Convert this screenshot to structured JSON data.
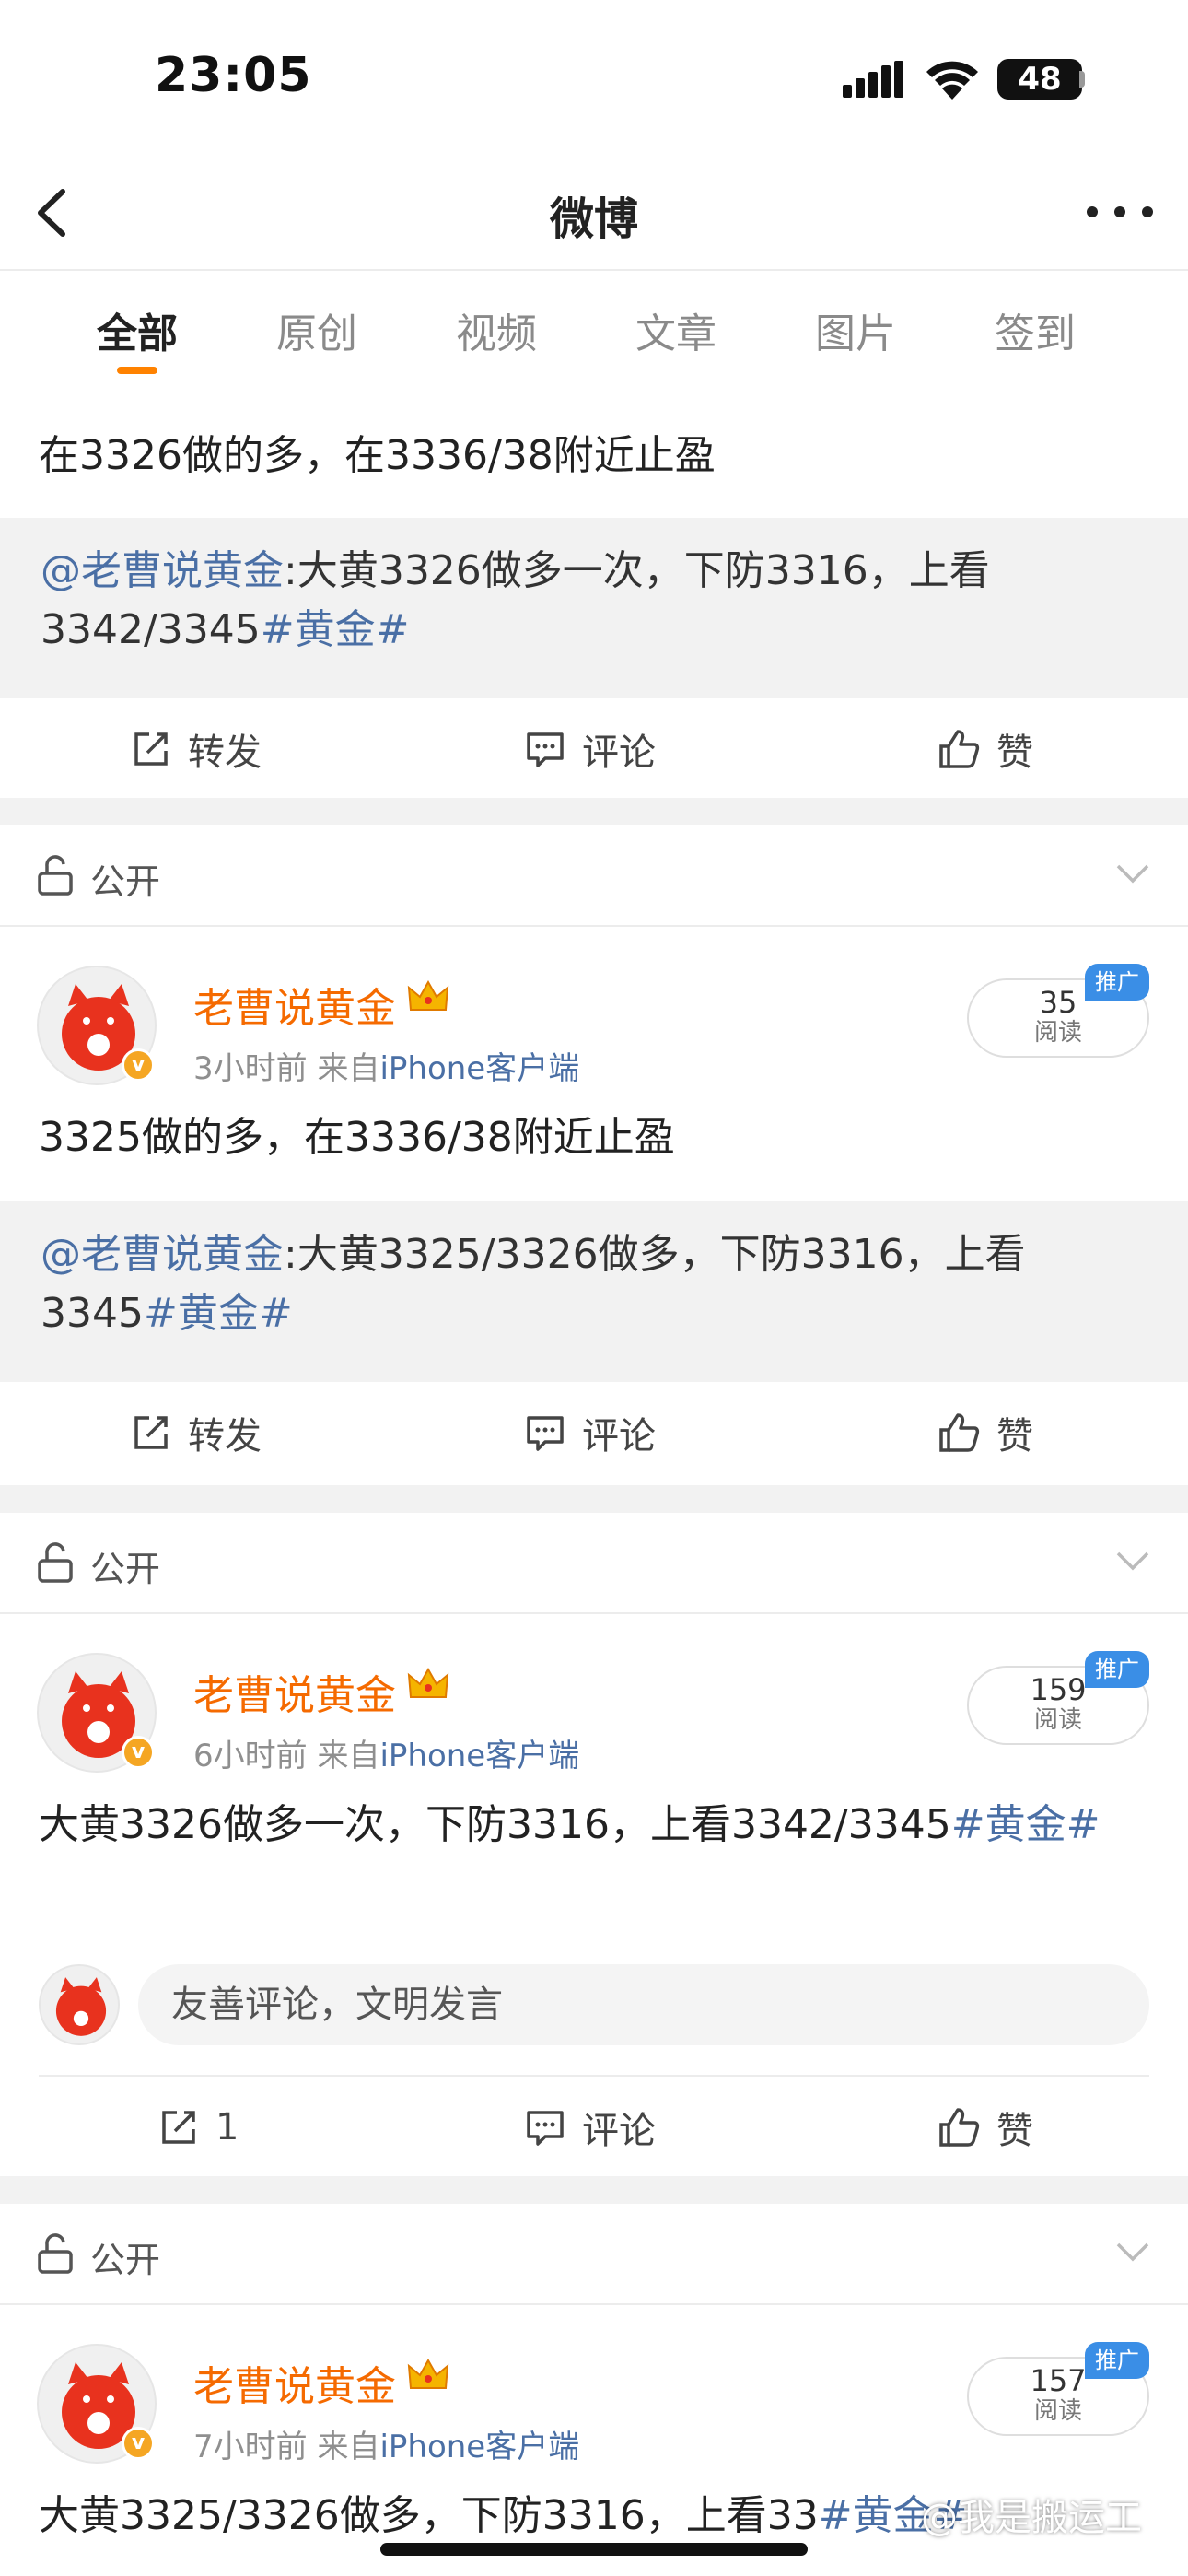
{
  "status_bar": {
    "time": "23:05",
    "battery": "48"
  },
  "nav": {
    "title": "微博"
  },
  "tabs": [
    {
      "label": "全部",
      "active": true
    },
    {
      "label": "原创"
    },
    {
      "label": "视频"
    },
    {
      "label": "文章"
    },
    {
      "label": "图片"
    },
    {
      "label": "签到"
    }
  ],
  "colors": {
    "accent": "#ff8200",
    "author": "#f56a00",
    "link": "#4a6fa5",
    "promo": "#3a8ee6"
  },
  "posts": [
    {
      "text": "在3326做的多，在3336/38附近止盈",
      "repost_author": "@老曹说黄金",
      "repost_text": ":大黄3326做多一次，下防3316，上看3342/3345",
      "repost_topic": "#黄金#",
      "actions": {
        "repost": "转发",
        "comment": "评论",
        "like": "赞"
      }
    },
    {
      "visibility": "公开",
      "author": "老曹说黄金",
      "time": "3小时前",
      "source_prefix": "来自",
      "source": "iPhone客户端",
      "reads": "35",
      "reads_label": "阅读",
      "promo": "推广",
      "text": "3325做的多，在3336/38附近止盈",
      "repost_author": "@老曹说黄金",
      "repost_text": ":大黄3325/3326做多，下防3316，上看3345",
      "repost_topic": "#黄金#",
      "actions": {
        "repost": "转发",
        "comment": "评论",
        "like": "赞"
      }
    },
    {
      "visibility": "公开",
      "author": "老曹说黄金",
      "time": "6小时前",
      "source_prefix": "来自",
      "source": "iPhone客户端",
      "reads": "159",
      "reads_label": "阅读",
      "promo": "推广",
      "text": "大黄3326做多一次，下防3316，上看3342/3345",
      "topic": "#黄金#",
      "comment_placeholder": "友善评论，文明发言",
      "actions": {
        "repost": "1",
        "comment": "评论",
        "like": "赞"
      }
    },
    {
      "visibility": "公开",
      "author": "老曹说黄金",
      "time": "7小时前",
      "source_prefix": "来自",
      "source": "iPhone客户端",
      "reads": "157",
      "reads_label": "阅读",
      "promo": "推广",
      "text": "大黄3325/3326做多，下防3316，上看33",
      "topic": "#黄金#"
    }
  ],
  "watermark": "@我是搬运工"
}
